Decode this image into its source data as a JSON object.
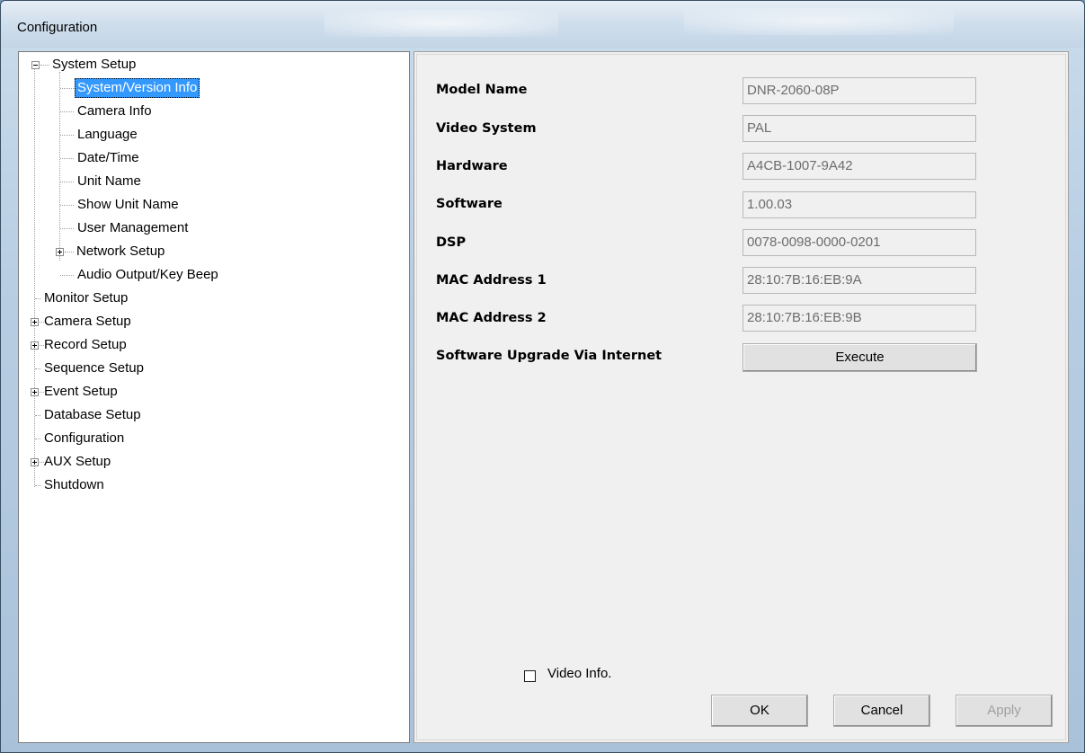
{
  "window": {
    "title": "Configuration"
  },
  "tree": {
    "items": [
      {
        "label": "System Setup",
        "level": 0,
        "expander": "minus",
        "selected": false
      },
      {
        "label": "System/Version Info",
        "level": 1,
        "expander": "none",
        "selected": true
      },
      {
        "label": "Camera Info",
        "level": 1,
        "expander": "none",
        "selected": false
      },
      {
        "label": "Language",
        "level": 1,
        "expander": "none",
        "selected": false
      },
      {
        "label": "Date/Time",
        "level": 1,
        "expander": "none",
        "selected": false
      },
      {
        "label": "Unit Name",
        "level": 1,
        "expander": "none",
        "selected": false
      },
      {
        "label": "Show Unit Name",
        "level": 1,
        "expander": "none",
        "selected": false
      },
      {
        "label": "User Management",
        "level": 1,
        "expander": "none",
        "selected": false
      },
      {
        "label": "Network Setup",
        "level": 1,
        "expander": "plus",
        "selected": false
      },
      {
        "label": "Audio Output/Key Beep",
        "level": 1,
        "expander": "none",
        "selected": false
      },
      {
        "label": "Monitor Setup",
        "level": 0,
        "expander": "none",
        "selected": false
      },
      {
        "label": "Camera Setup",
        "level": 0,
        "expander": "plus",
        "selected": false
      },
      {
        "label": "Record Setup",
        "level": 0,
        "expander": "plus",
        "selected": false
      },
      {
        "label": "Sequence Setup",
        "level": 0,
        "expander": "none",
        "selected": false
      },
      {
        "label": "Event Setup",
        "level": 0,
        "expander": "plus",
        "selected": false
      },
      {
        "label": "Database Setup",
        "level": 0,
        "expander": "none",
        "selected": false
      },
      {
        "label": "Configuration",
        "level": 0,
        "expander": "none",
        "selected": false
      },
      {
        "label": "AUX Setup",
        "level": 0,
        "expander": "plus",
        "selected": false
      },
      {
        "label": "Shutdown",
        "level": 0,
        "expander": "none",
        "selected": false
      }
    ]
  },
  "info": {
    "model_name": {
      "label": "Model Name",
      "value": "DNR-2060-08P"
    },
    "video_system": {
      "label": "Video System",
      "value": "PAL"
    },
    "hardware": {
      "label": "Hardware",
      "value": "A4CB-1007-9A42"
    },
    "software": {
      "label": "Software",
      "value": "1.00.03"
    },
    "dsp": {
      "label": "DSP",
      "value": "0078-0098-0000-0201"
    },
    "mac1": {
      "label": "MAC Address 1",
      "value": "28:10:7B:16:EB:9A"
    },
    "mac2": {
      "label": "MAC Address 2",
      "value": "28:10:7B:16:EB:9B"
    },
    "upgrade": {
      "label": "Software Upgrade Via Internet",
      "button": "Execute"
    }
  },
  "video_info": {
    "label": "Video Info.",
    "checked": false
  },
  "buttons": {
    "ok": "OK",
    "cancel": "Cancel",
    "apply": "Apply",
    "apply_enabled": false
  }
}
